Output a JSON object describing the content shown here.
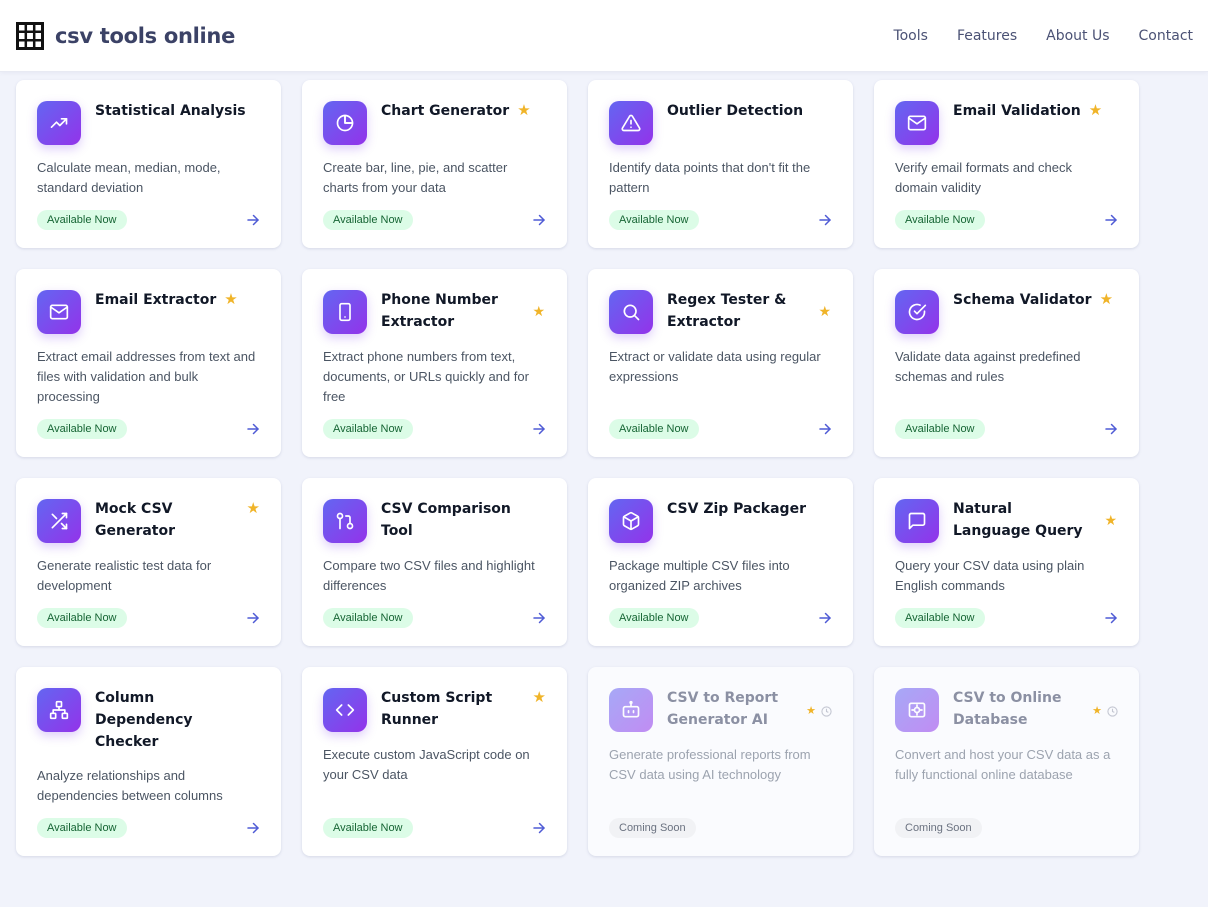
{
  "header": {
    "logo_text": "csv tools online",
    "nav": [
      "Tools",
      "Features",
      "About Us",
      "Contact"
    ]
  },
  "colors": {
    "accent_from": "#6366f1",
    "accent_to": "#9333ea",
    "star": "#f0b429",
    "available_bg": "#dcfce7",
    "available_text": "#166534"
  },
  "tools": [
    {
      "title": "Statistical Analysis",
      "description": "Calculate mean, median, mode, standard deviation",
      "status": "Available Now",
      "starred": false,
      "icon": "trend-up-icon"
    },
    {
      "title": "Chart Generator",
      "description": "Create bar, line, pie, and scatter charts from your data",
      "status": "Available Now",
      "starred": true,
      "icon": "pie-chart-icon"
    },
    {
      "title": "Outlier Detection",
      "description": "Identify data points that don't fit the pattern",
      "status": "Available Now",
      "starred": false,
      "icon": "warning-triangle-icon"
    },
    {
      "title": "Email Validation",
      "description": "Verify email formats and check domain validity",
      "status": "Available Now",
      "starred": true,
      "icon": "mail-icon"
    },
    {
      "title": "Email Extractor",
      "description": "Extract email addresses from text and files with validation and bulk processing",
      "status": "Available Now",
      "starred": true,
      "icon": "mail-icon"
    },
    {
      "title": "Phone Number Extractor",
      "description": "Extract phone numbers from text, documents, or URLs quickly and for free",
      "status": "Available Now",
      "starred": true,
      "icon": "phone-icon"
    },
    {
      "title": "Regex Tester & Extractor",
      "description": "Extract or validate data using regular expressions",
      "status": "Available Now",
      "starred": true,
      "icon": "search-icon"
    },
    {
      "title": "Schema Validator",
      "description": "Validate data against predefined schemas and rules",
      "status": "Available Now",
      "starred": true,
      "icon": "check-circle-icon"
    },
    {
      "title": "Mock CSV Generator",
      "description": "Generate realistic test data for development",
      "status": "Available Now",
      "starred": true,
      "icon": "shuffle-icon"
    },
    {
      "title": "CSV Comparison Tool",
      "description": "Compare two CSV files and highlight differences",
      "status": "Available Now",
      "starred": false,
      "icon": "git-compare-icon"
    },
    {
      "title": "CSV Zip Packager",
      "description": "Package multiple CSV files into organized ZIP archives",
      "status": "Available Now",
      "starred": false,
      "icon": "package-icon"
    },
    {
      "title": "Natural Language Query",
      "description": "Query your CSV data using plain English commands",
      "status": "Available Now",
      "starred": true,
      "icon": "message-icon"
    },
    {
      "title": "Column Dependency Checker",
      "description": "Analyze relationships and dependencies between columns",
      "status": "Available Now",
      "starred": false,
      "icon": "hierarchy-icon"
    },
    {
      "title": "Custom Script Runner",
      "description": "Execute custom JavaScript code on your CSV data",
      "status": "Available Now",
      "starred": true,
      "icon": "code-icon"
    },
    {
      "title": "CSV to Report Generator AI",
      "description": "Generate professional reports from CSV data using AI technology",
      "status": "Coming Soon",
      "starred": true,
      "icon": "bot-icon"
    },
    {
      "title": "CSV to Online Database",
      "description": "Convert and host your CSV data as a fully functional online database",
      "status": "Coming Soon",
      "starred": true,
      "icon": "database-icon"
    }
  ]
}
